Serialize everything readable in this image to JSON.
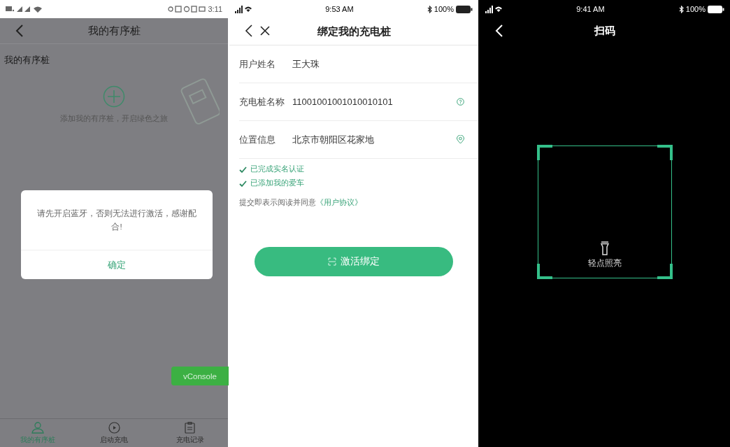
{
  "bluetooth_prompt_screen": {
    "status_bar": {
      "time": "3:11"
    },
    "header": {
      "title": "我的有序桩"
    },
    "section_title": "我的有序桩",
    "add_card": {
      "text": "添加我的有序桩，开启绿色之旅"
    },
    "dialog": {
      "message": "请先开启蓝牙，否则无法进行激活，感谢配合!",
      "confirm": "确定"
    },
    "vconsole_button": "vConsole",
    "tab_bar": [
      {
        "label": "我的有序桩",
        "selected": true
      },
      {
        "label": "启动充电",
        "selected": false
      },
      {
        "label": "充电记录",
        "selected": false
      }
    ]
  },
  "bind_screen": {
    "status_bar": {
      "time": "9:53 AM",
      "battery": "100%"
    },
    "header": {
      "title": "绑定我的充电桩"
    },
    "fields": [
      {
        "label": "用户姓名",
        "value": "王大珠"
      },
      {
        "label": "充电桩名称",
        "value": "11001001001010010101"
      },
      {
        "label": "位置信息",
        "value": "北京市朝阳区花家地"
      }
    ],
    "checks": [
      {
        "text": "已完成实名认证",
        "checked": true
      },
      {
        "text": "已添加我的爱车",
        "checked": true
      }
    ],
    "agreement": {
      "text": "提交即表示阅读并同意",
      "link": "《用户协议》"
    },
    "submit_button": "激活绑定"
  },
  "scan_screen": {
    "status_bar": {
      "time": "9:41 AM",
      "battery": "100%"
    },
    "header": {
      "title": "扫码"
    },
    "torch_label": "轻点照亮"
  }
}
